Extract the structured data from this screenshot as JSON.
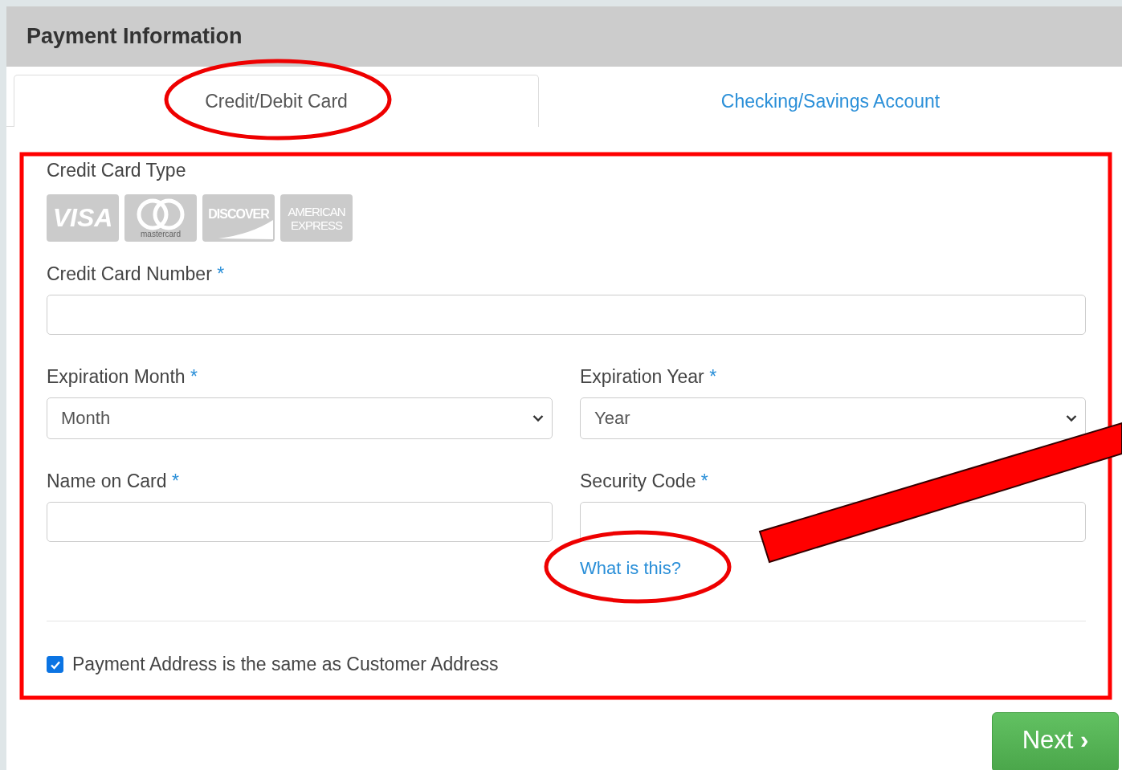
{
  "header": {
    "title": "Payment Information"
  },
  "tabs": [
    {
      "label": "Credit/Debit Card",
      "selected": true
    },
    {
      "label": "Checking/Savings Account",
      "selected": false
    }
  ],
  "card_type": {
    "label": "Credit Card Type",
    "cards": [
      {
        "kind": "visa",
        "label": "VISA"
      },
      {
        "kind": "mastercard",
        "label": "mastercard"
      },
      {
        "kind": "discover",
        "label": "DISCOVER"
      },
      {
        "kind": "amex",
        "label": "AMERICAN EXPRESS"
      }
    ]
  },
  "card_number": {
    "label": "Credit Card Number",
    "required": "*"
  },
  "expiration_month": {
    "label": "Expiration Month",
    "required": "*",
    "value": "Month"
  },
  "expiration_year": {
    "label": "Expiration Year",
    "required": "*",
    "value": "Year"
  },
  "name_on_card": {
    "label": "Name on Card",
    "required": "*"
  },
  "security_code": {
    "label": "Security Code",
    "required": "*",
    "help_link": "What is this?"
  },
  "same_address": {
    "label": "Payment Address is the same as Customer Address",
    "checked": true
  },
  "next_button": {
    "label": "Next",
    "icon": "›"
  }
}
